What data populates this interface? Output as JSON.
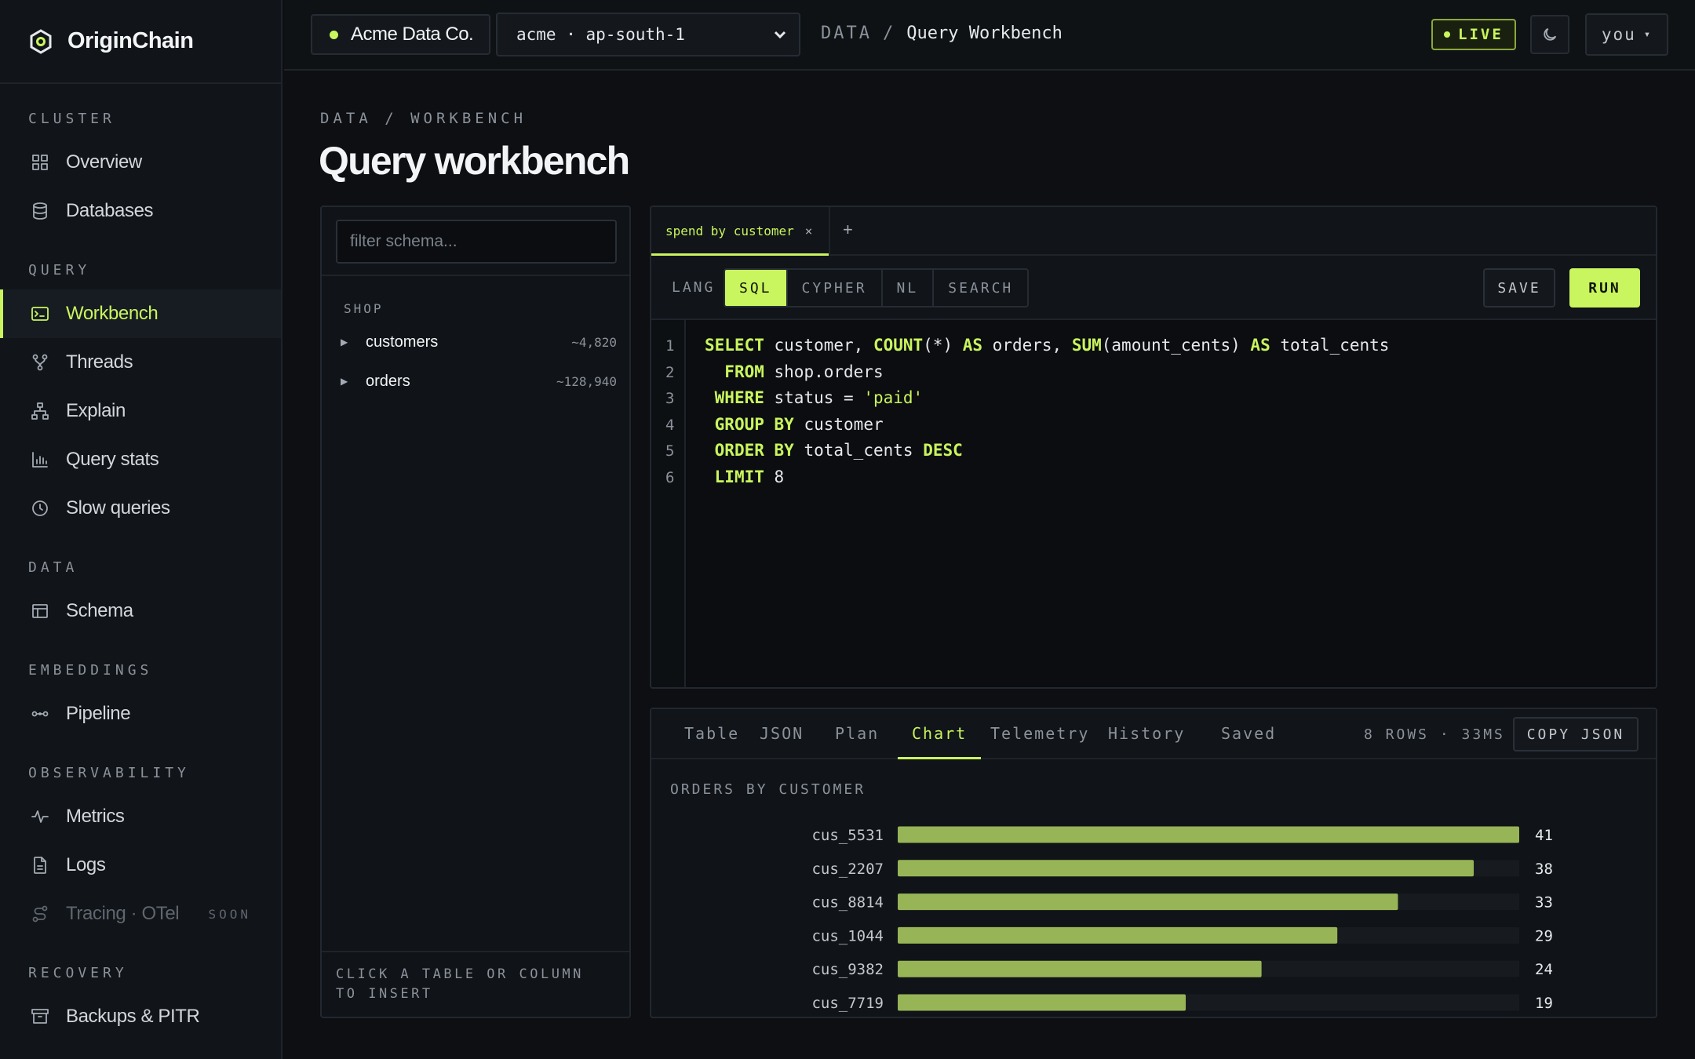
{
  "brand": {
    "name": "OriginChain"
  },
  "sidebar": {
    "sections": [
      {
        "title": "CLUSTER",
        "items": [
          {
            "id": "overview",
            "label": "Overview",
            "icon": "grid-icon"
          },
          {
            "id": "databases",
            "label": "Databases",
            "icon": "database-icon"
          }
        ]
      },
      {
        "title": "QUERY",
        "items": [
          {
            "id": "workbench",
            "label": "Workbench",
            "icon": "terminal-icon",
            "active": true
          },
          {
            "id": "threads",
            "label": "Threads",
            "icon": "branch-icon"
          },
          {
            "id": "explain",
            "label": "Explain",
            "icon": "tree-icon"
          },
          {
            "id": "query-stats",
            "label": "Query stats",
            "icon": "bar-chart-icon"
          },
          {
            "id": "slow-queries",
            "label": "Slow queries",
            "icon": "clock-icon"
          }
        ]
      },
      {
        "title": "DATA",
        "items": [
          {
            "id": "schema",
            "label": "Schema",
            "icon": "table-icon"
          }
        ]
      },
      {
        "title": "EMBEDDINGS",
        "items": [
          {
            "id": "pipeline",
            "label": "Pipeline",
            "icon": "pipeline-icon"
          }
        ]
      },
      {
        "title": "OBSERVABILITY",
        "items": [
          {
            "id": "metrics",
            "label": "Metrics",
            "icon": "pulse-icon"
          },
          {
            "id": "logs",
            "label": "Logs",
            "icon": "file-icon"
          },
          {
            "id": "tracing",
            "label": "Tracing · OTel",
            "icon": "route-icon",
            "disabled": true,
            "badge": "SOON"
          }
        ]
      },
      {
        "title": "RECOVERY",
        "items": [
          {
            "id": "backups",
            "label": "Backups & PITR",
            "icon": "archive-icon"
          }
        ]
      }
    ]
  },
  "topbar": {
    "org": "Acme Data Co.",
    "region": "acme · ap-south-1",
    "crumb_section": "DATA",
    "crumb_sep": "/",
    "crumb_current": "Query Workbench",
    "live": "LIVE",
    "user": "you",
    "user_caret": "▾"
  },
  "page": {
    "crumb": "DATA / WORKBENCH",
    "title": "Query workbench"
  },
  "schema": {
    "filter_placeholder": "filter schema...",
    "group": "SHOP",
    "tables": [
      {
        "name": "customers",
        "count": "~4,820"
      },
      {
        "name": "orders",
        "count": "~128,940"
      }
    ],
    "footer": "CLICK A TABLE OR COLUMN TO INSERT"
  },
  "editor": {
    "tab_label": "spend by customer",
    "tab_close": "×",
    "add_tab": "+",
    "lang_label": "LANG",
    "langs": [
      "SQL",
      "CYPHER",
      "NL",
      "SEARCH"
    ],
    "active_lang": "SQL",
    "save": "SAVE",
    "run": "RUN",
    "lines": [
      [
        [
          "kw",
          "SELECT"
        ],
        [
          "t",
          " customer, "
        ],
        [
          "kw",
          "COUNT"
        ],
        [
          "t",
          "(*) "
        ],
        [
          "kw",
          "AS"
        ],
        [
          "t",
          " orders, "
        ],
        [
          "kw",
          "SUM"
        ],
        [
          "t",
          "(amount_cents) "
        ],
        [
          "kw",
          "AS"
        ],
        [
          "t",
          " total_cents"
        ]
      ],
      [
        [
          "t",
          "  "
        ],
        [
          "kw",
          "FROM"
        ],
        [
          "t",
          " shop.orders"
        ]
      ],
      [
        [
          "t",
          " "
        ],
        [
          "kw",
          "WHERE"
        ],
        [
          "t",
          " status = "
        ],
        [
          "str",
          "'paid'"
        ]
      ],
      [
        [
          "t",
          " "
        ],
        [
          "kw",
          "GROUP BY"
        ],
        [
          "t",
          " customer"
        ]
      ],
      [
        [
          "t",
          " "
        ],
        [
          "kw",
          "ORDER BY"
        ],
        [
          "t",
          " total_cents "
        ],
        [
          "kw",
          "DESC"
        ]
      ],
      [
        [
          "t",
          " "
        ],
        [
          "kw",
          "LIMIT"
        ],
        [
          "t",
          " 8"
        ]
      ]
    ]
  },
  "results": {
    "tabs": [
      "Table",
      "JSON",
      "Plan",
      "Chart",
      "Telemetry",
      "History",
      "Saved"
    ],
    "active_tab": "Chart",
    "meta": "8 ROWS · 33MS",
    "copy": "COPY JSON"
  },
  "chart_data": {
    "type": "bar",
    "orientation": "horizontal",
    "title": "ORDERS BY CUSTOMER",
    "categories": [
      "cus_5531",
      "cus_2207",
      "cus_8814",
      "cus_1044",
      "cus_9382",
      "cus_7719"
    ],
    "values": [
      41,
      38,
      33,
      29,
      24,
      19
    ],
    "xlim": [
      0,
      41
    ],
    "bar_color": "#97b556",
    "track_color": "#171b20",
    "grid": false
  },
  "colors": {
    "accent": "#c9f55e",
    "background": "#0d0f12",
    "panel": "#101317"
  }
}
